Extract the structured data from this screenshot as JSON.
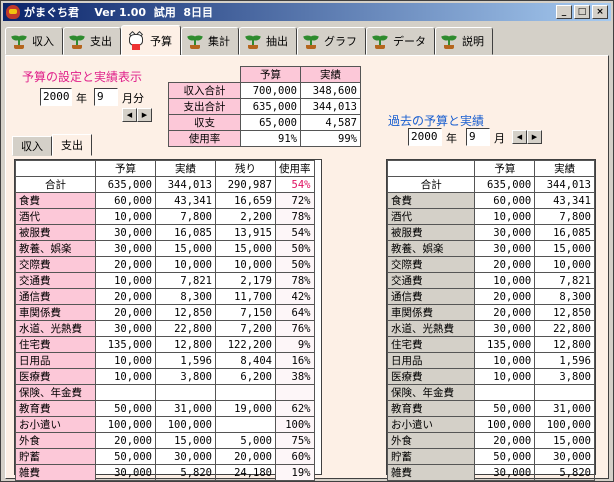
{
  "window": {
    "title": "がまぐち君    Ver 1.00  試用  8日目",
    "buttons": [
      "_",
      "□",
      "×"
    ]
  },
  "tabs": [
    {
      "label": "収入",
      "icon": "sprout-icon"
    },
    {
      "label": "支出",
      "icon": "sprout-icon"
    },
    {
      "label": "予算",
      "icon": "maneki-neko-icon",
      "active": true
    },
    {
      "label": "集計",
      "icon": "sprout-icon"
    },
    {
      "label": "抽出",
      "icon": "sprout-icon"
    },
    {
      "label": "グラフ",
      "icon": "sprout-icon"
    },
    {
      "label": "データ",
      "icon": "sprout-icon"
    },
    {
      "label": "説明",
      "icon": "sprout-icon"
    }
  ],
  "budget_header": "予算の設定と実績表示",
  "year": "2000",
  "year_label": "年",
  "month": "9",
  "month_label": "月分",
  "past_header": "過去の予算と実績",
  "past_year": "2000",
  "past_year_label": "年",
  "past_month": "9",
  "past_month_label": "月",
  "summary": {
    "cols": [
      "予算",
      "実績"
    ],
    "rows": [
      {
        "label": "収入合計",
        "budget": "700,000",
        "actual": "348,600"
      },
      {
        "label": "支出合計",
        "budget": "635,000",
        "actual": "344,013"
      },
      {
        "label": "収支",
        "budget": "65,000",
        "actual": "4,587"
      },
      {
        "label": "使用率",
        "budget": "91%",
        "actual": "99%"
      }
    ]
  },
  "subtabs": [
    "収入",
    "支出"
  ],
  "left": {
    "cols": [
      "予算",
      "実績",
      "残り",
      "使用率"
    ],
    "total": {
      "label": "合計",
      "budget": "635,000",
      "actual": "344,013",
      "rest": "290,987",
      "rate": "54%"
    },
    "rows": [
      [
        "食費",
        "60,000",
        "43,341",
        "16,659",
        "72%"
      ],
      [
        "酒代",
        "10,000",
        "7,800",
        "2,200",
        "78%"
      ],
      [
        "被服費",
        "30,000",
        "16,085",
        "13,915",
        "54%"
      ],
      [
        "教養、娯楽",
        "30,000",
        "15,000",
        "15,000",
        "50%"
      ],
      [
        "交際費",
        "20,000",
        "10,000",
        "10,000",
        "50%"
      ],
      [
        "交通費",
        "10,000",
        "7,821",
        "2,179",
        "78%"
      ],
      [
        "通信費",
        "20,000",
        "8,300",
        "11,700",
        "42%"
      ],
      [
        "車関係費",
        "20,000",
        "12,850",
        "7,150",
        "64%"
      ],
      [
        "水道、光熱費",
        "30,000",
        "22,800",
        "7,200",
        "76%"
      ],
      [
        "住宅費",
        "135,000",
        "12,800",
        "122,200",
        "9%"
      ],
      [
        "日用品",
        "10,000",
        "1,596",
        "8,404",
        "16%"
      ],
      [
        "医療費",
        "10,000",
        "3,800",
        "6,200",
        "38%"
      ],
      [
        "保険、年金費",
        "",
        "",
        "",
        ""
      ],
      [
        "教育費",
        "50,000",
        "31,000",
        "19,000",
        "62%"
      ],
      [
        "お小遣い",
        "100,000",
        "100,000",
        "",
        "100%"
      ],
      [
        "外食",
        "20,000",
        "15,000",
        "5,000",
        "75%"
      ],
      [
        "貯蓄",
        "50,000",
        "30,000",
        "20,000",
        "60%"
      ],
      [
        "雑費",
        "30,000",
        "5,820",
        "24,180",
        "19%"
      ]
    ]
  },
  "right": {
    "cols": [
      "予算",
      "実績"
    ],
    "total": {
      "label": "合計",
      "budget": "635,000",
      "actual": "344,013"
    },
    "rows": [
      [
        "食費",
        "60,000",
        "43,341"
      ],
      [
        "酒代",
        "10,000",
        "7,800"
      ],
      [
        "被服費",
        "30,000",
        "16,085"
      ],
      [
        "教養、娯楽",
        "30,000",
        "15,000"
      ],
      [
        "交際費",
        "20,000",
        "10,000"
      ],
      [
        "交通費",
        "10,000",
        "7,821"
      ],
      [
        "通信費",
        "20,000",
        "8,300"
      ],
      [
        "車関係費",
        "20,000",
        "12,850"
      ],
      [
        "水道、光熱費",
        "30,000",
        "22,800"
      ],
      [
        "住宅費",
        "135,000",
        "12,800"
      ],
      [
        "日用品",
        "10,000",
        "1,596"
      ],
      [
        "医療費",
        "10,000",
        "3,800"
      ],
      [
        "保険、年金費",
        "",
        ""
      ],
      [
        "教育費",
        "50,000",
        "31,000"
      ],
      [
        "お小遣い",
        "100,000",
        "100,000"
      ],
      [
        "外食",
        "20,000",
        "15,000"
      ],
      [
        "貯蓄",
        "50,000",
        "30,000"
      ],
      [
        "雑費",
        "30,000",
        "5,820"
      ]
    ]
  }
}
